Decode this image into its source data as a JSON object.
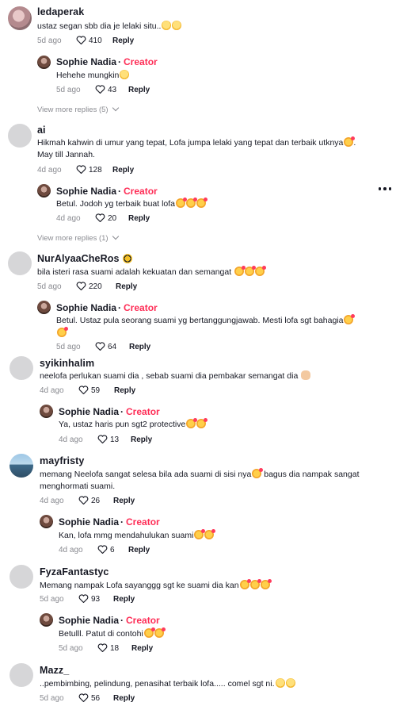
{
  "comments": [
    {
      "username": "ledaperak",
      "text": "ustaz segan sbb dia je lelaki situ..",
      "emoji": [
        "grin",
        "grin"
      ],
      "age": "5d ago",
      "likes": "410",
      "reply_label": "Reply",
      "replies": [
        {
          "username": "Sophie Nadia",
          "badge": "Creator",
          "text": "Hehehe mungkin",
          "emoji": [
            "grin"
          ],
          "age": "5d ago",
          "likes": "43",
          "reply_label": "Reply"
        }
      ],
      "view_more": "View more replies (5)"
    },
    {
      "username": "ai",
      "text": "Hikmah kahwin di umur yang tepat, Lofa jumpa lelaki yang tepat dan terbaik utknya",
      "text_suffix": ".",
      "text_line2": "May till Jannah.",
      "emoji": [
        "love"
      ],
      "age": "4d ago",
      "likes": "128",
      "reply_label": "Reply",
      "replies": [
        {
          "username": "Sophie Nadia",
          "badge": "Creator",
          "text": "Betul. Jodoh yg terbaik buat lofa",
          "emoji": [
            "love",
            "love",
            "love"
          ],
          "age": "4d ago",
          "likes": "20",
          "reply_label": "Reply"
        }
      ],
      "view_more": "View more replies (1)"
    },
    {
      "username": "NurAlyaaCheRos",
      "username_emoji": "bee",
      "text": "bila isteri rasa suami adalah kekuatan dan semangat",
      "emoji": [
        "love",
        "love",
        "love"
      ],
      "age": "5d ago",
      "likes": "220",
      "reply_label": "Reply",
      "replies": [
        {
          "username": "Sophie Nadia",
          "badge": "Creator",
          "text": "Betul. Ustaz pula seorang suami yg bertanggungjawab. Mesti lofa sgt bahagia",
          "emoji": [
            "love"
          ],
          "line2_emoji": [
            "love"
          ],
          "age": "5d ago",
          "likes": "64",
          "reply_label": "Reply"
        }
      ]
    },
    {
      "username": "syikinhalim",
      "text": "neelofa perlukan suami dia , sebab suami dia pembakar semangat dia",
      "emoji": [
        "arm"
      ],
      "age": "4d ago",
      "likes": "59",
      "reply_label": "Reply",
      "replies": [
        {
          "username": "Sophie Nadia",
          "badge": "Creator",
          "text": "Ya, ustaz haris pun sgt2 protective",
          "emoji": [
            "love",
            "love"
          ],
          "age": "4d ago",
          "likes": "13",
          "reply_label": "Reply"
        }
      ]
    },
    {
      "username": "mayfristy",
      "text": "memang Neelofa sangat selesa bila ada suami di sisi nya",
      "text_mid_emoji": [
        "love"
      ],
      "text_after": " bagus dia nampak sangat",
      "text_line2": "menghormati suami.",
      "age": "4d ago",
      "likes": "26",
      "reply_label": "Reply",
      "replies": [
        {
          "username": "Sophie Nadia",
          "badge": "Creator",
          "text": "Kan, lofa mmg mendahulukan suami",
          "emoji": [
            "love",
            "love"
          ],
          "age": "4d ago",
          "likes": "6",
          "reply_label": "Reply"
        }
      ]
    },
    {
      "username": "FyzaFantastyc",
      "text": "Memang nampak Lofa sayanggg sgt ke suami dia kan",
      "emoji": [
        "love",
        "love",
        "love"
      ],
      "age": "5d ago",
      "likes": "93",
      "reply_label": "Reply",
      "replies": [
        {
          "username": "Sophie Nadia",
          "badge": "Creator",
          "text": "Betulll. Patut di contohi",
          "emoji": [
            "love",
            "love"
          ],
          "age": "5d ago",
          "likes": "18",
          "reply_label": "Reply"
        }
      ]
    },
    {
      "username": "Mazz_",
      "text": "..pembimbing, pelindung, penasihat terbaik lofa..... comel sgt ni.",
      "emoji": [
        "grin",
        "grin"
      ],
      "age": "5d ago",
      "likes": "56",
      "reply_label": "Reply"
    }
  ],
  "theme": {
    "accent": "#fe2c55",
    "text": "#161823",
    "muted": "#8a8b91"
  },
  "icons": {
    "like": "heart-outline-icon",
    "more": "more-horizontal-icon",
    "expand": "chevron-down-icon"
  }
}
